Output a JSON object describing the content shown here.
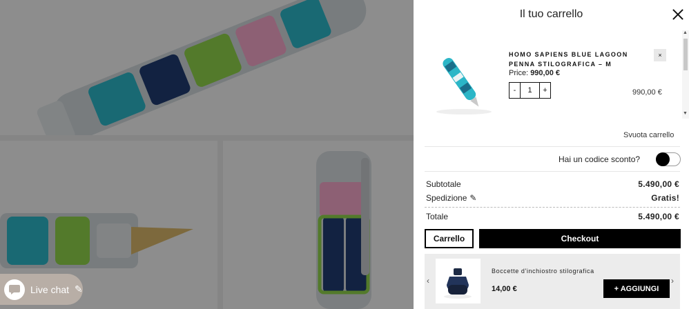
{
  "drawer": {
    "title": "Il tuo carrello"
  },
  "item": {
    "name": "HOMO SAPIENS BLUE LAGOON PENNA STILOGRAFICA – M",
    "price_label": "Price:",
    "price_value": "990,00 €",
    "quantity": "1",
    "minus": "-",
    "plus": "+",
    "line_total": "990,00 €",
    "remove": "×"
  },
  "cart": {
    "empty_label": "Svuota carrello",
    "discount_label": "Hai un codice sconto?",
    "subtotal_label": "Subtotale",
    "subtotal_value": "5.490,00 €",
    "shipping_label": "Spedizione",
    "shipping_value": "Gratis!",
    "total_label": "Totale",
    "total_value": "5.490,00 €",
    "cart_button": "Carrello",
    "checkout_button": "Checkout"
  },
  "upsell": {
    "name": "Boccette d'inchiostro stilografica",
    "price": "14,00 €",
    "add_button": "+ AGGIUNGI",
    "prev": "‹",
    "next": "›"
  },
  "chat": {
    "label": "Live chat"
  },
  "colors": {
    "accent": "#000000",
    "overlay": "rgba(0,0,0,0.42)",
    "chat_bg": "#b8aea6"
  }
}
